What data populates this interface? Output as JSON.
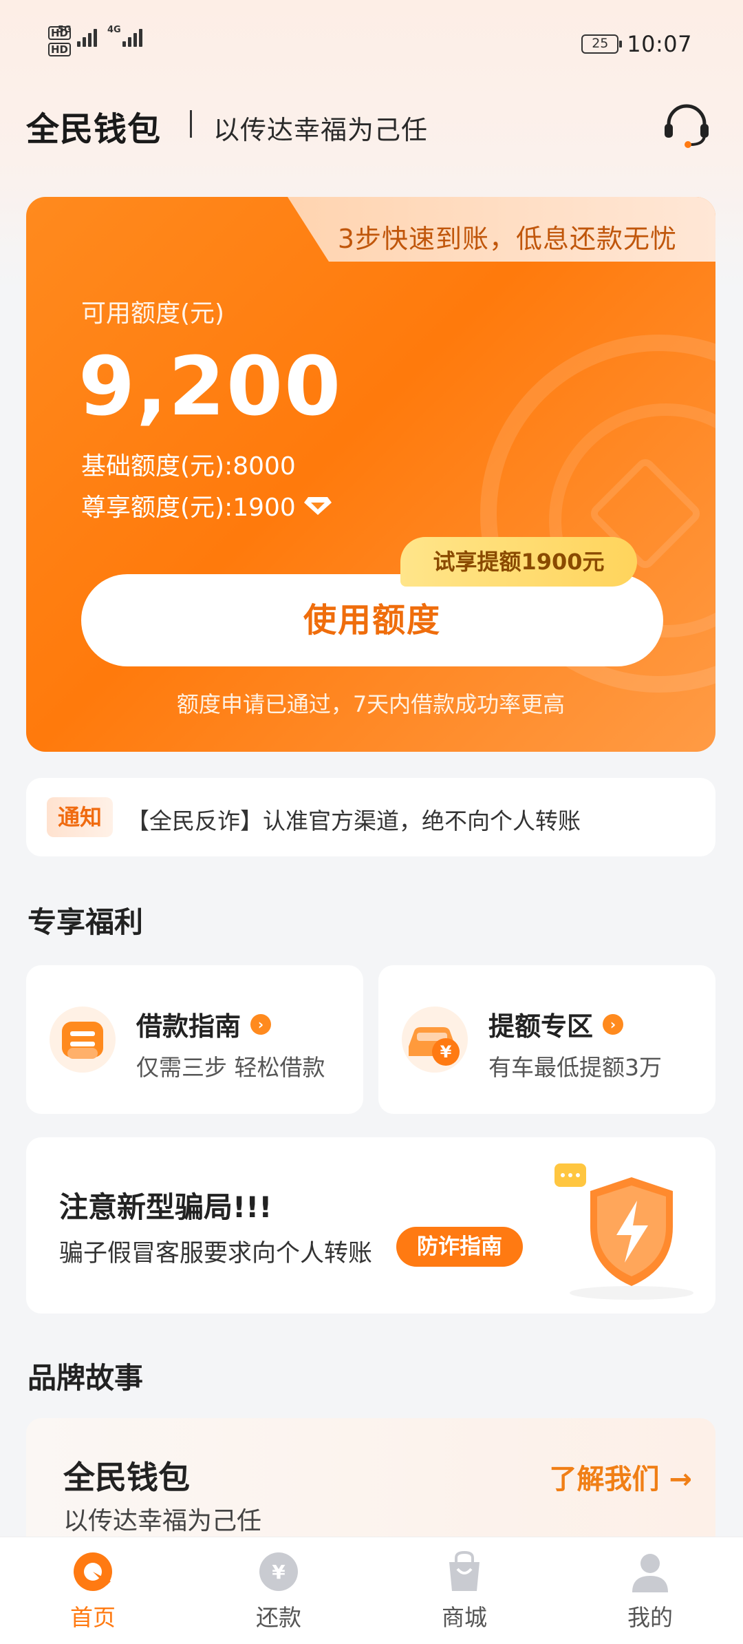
{
  "status_bar": {
    "time": "10:07",
    "battery": "25",
    "network_1": "5G",
    "network_2": "4G"
  },
  "header": {
    "brand": "全民钱包",
    "slogan": "以传达幸福为己任",
    "service_icon": "headset-icon"
  },
  "credit_card": {
    "tab_text": "3步快速到账，低息还款无忧",
    "limit_label": "可用额度(元)",
    "limit_value": "9,200",
    "base_limit": "基础额度(元):8000",
    "vip_limit": "尊享额度(元):1900",
    "trial_tag": "试享提额1900元",
    "use_button": "使用额度",
    "approved_text": "额度申请已通过，7天内借款成功率更高"
  },
  "notice": {
    "tag": "通知",
    "text": "【全民反诈】认准官方渠道，绝不向个人转账"
  },
  "welfare": {
    "title": "专享福利",
    "items": [
      {
        "title": "借款指南",
        "subtitle": "仅需三步 轻松借款",
        "icon": "guide-icon"
      },
      {
        "title": "提额专区",
        "subtitle": "有车最低提额3万",
        "icon": "car-coin-icon"
      }
    ]
  },
  "fraud": {
    "title": "注意新型骗局!!!",
    "subtitle": "骗子假冒客服要求向个人转账",
    "button": "防诈指南"
  },
  "brand_story": {
    "section_title": "品牌故事",
    "title": "全民钱包",
    "subtitle": "以传达幸福为己任",
    "link": "了解我们 →"
  },
  "tabbar": {
    "items": [
      {
        "label": "首页",
        "icon": "home-icon",
        "active": true
      },
      {
        "label": "还款",
        "icon": "yuan-coin-icon",
        "active": false
      },
      {
        "label": "商城",
        "icon": "shopping-bag-icon",
        "active": false
      },
      {
        "label": "我的",
        "icon": "user-icon",
        "active": false
      }
    ]
  },
  "colors": {
    "accent": "#ff7a12",
    "card_start": "#ff8a1e",
    "card_end": "#ff9b45",
    "bg": "#f4f5f7"
  }
}
